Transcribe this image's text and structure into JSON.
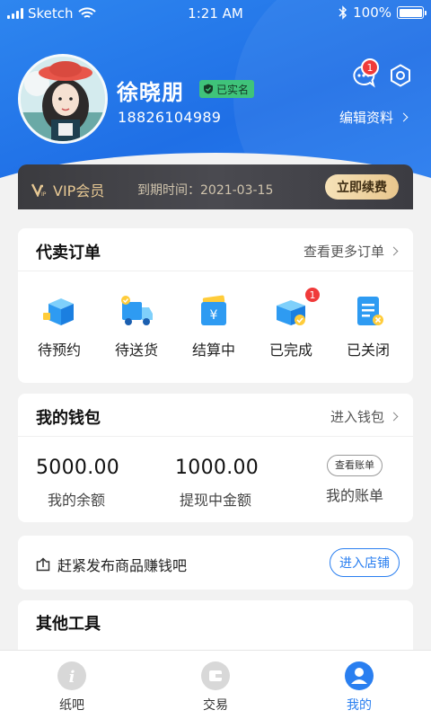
{
  "status_bar": {
    "carrier": "Sketch",
    "time": "1:21 AM",
    "battery": "100%"
  },
  "profile": {
    "name": "徐晓朋",
    "verified_label": "已实名",
    "phone": "18826104989",
    "edit_label": "编辑资料",
    "message_badge": "1"
  },
  "vip": {
    "label": "VIP会员",
    "expire_text": "到期时间：2021-03-15",
    "renew_label": "立即续费"
  },
  "orders": {
    "title": "代卖订单",
    "more_label": "查看更多订单",
    "items": [
      {
        "label": "待预约",
        "icon": "package-box-icon"
      },
      {
        "label": "待送货",
        "icon": "delivery-truck-icon"
      },
      {
        "label": "结算中",
        "icon": "wallet-yen-icon"
      },
      {
        "label": "已完成",
        "icon": "completed-box-icon",
        "badge": "1"
      },
      {
        "label": "已关闭",
        "icon": "closed-document-icon"
      }
    ]
  },
  "wallet": {
    "title": "我的钱包",
    "more_label": "进入钱包",
    "balance_value": "5000.00",
    "balance_label": "我的余额",
    "withdrawing_value": "1000.00",
    "withdrawing_label": "提现中金额",
    "bill_button": "查看账单",
    "bill_label": "我的账单"
  },
  "promo": {
    "text": "赶紧发布商品赚钱吧",
    "button": "进入店铺"
  },
  "tools": {
    "title": "其他工具"
  },
  "tabbar": {
    "items": [
      {
        "label": "纸吧",
        "icon": "info-icon"
      },
      {
        "label": "交易",
        "icon": "trade-icon"
      },
      {
        "label": "我的",
        "icon": "user-icon",
        "active": true
      }
    ]
  },
  "colors": {
    "primary": "#2a7ff0",
    "vip_gold": "#e8c994",
    "badge_red": "#f03a3a",
    "verified_green": "#3fc37a"
  }
}
